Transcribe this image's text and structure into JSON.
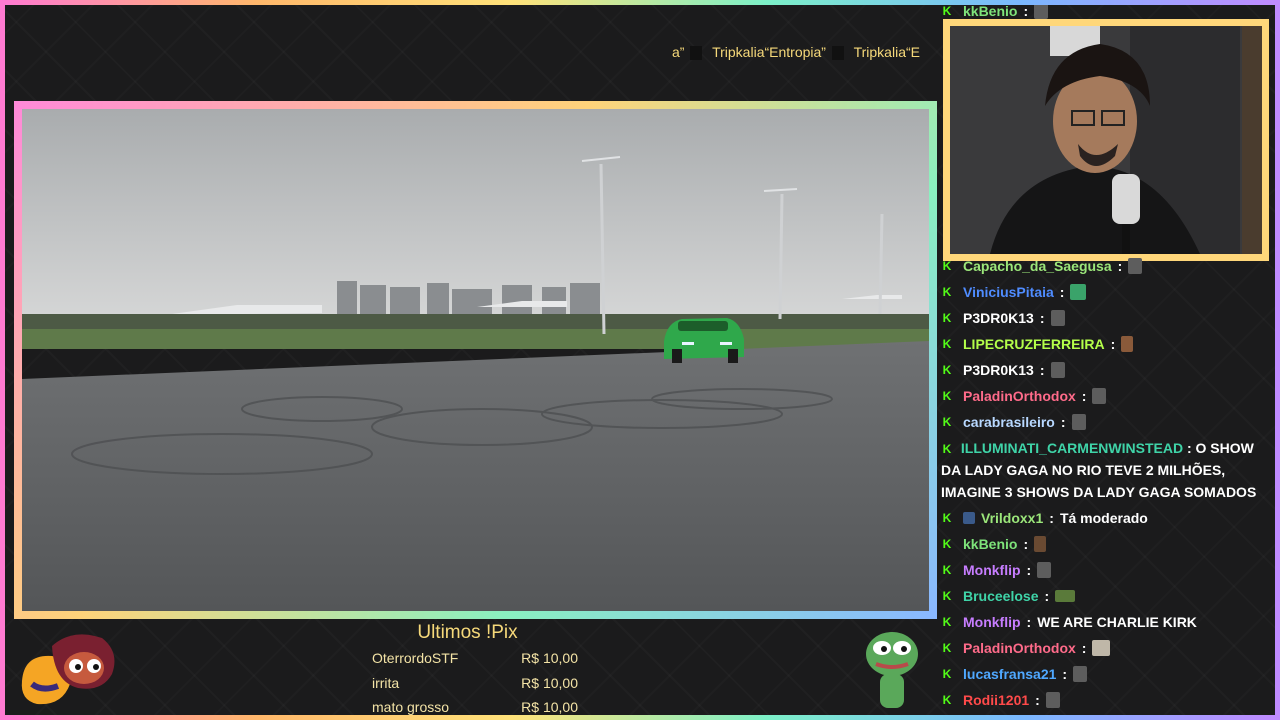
{
  "ticker": {
    "items": [
      "a”",
      "Tripkalia“Entropia”",
      "Tripkalia“E"
    ]
  },
  "pix": {
    "title": "Ultimos !Pix",
    "rows": [
      {
        "name": "OterrordoSTF",
        "amount": "R$ 10,00"
      },
      {
        "name": "irrita",
        "amount": "R$ 10,00"
      },
      {
        "name": "mato grosso",
        "amount": "R$ 10,00"
      }
    ]
  },
  "chat": {
    "badge_glyph": "K",
    "messages": [
      {
        "user": "kkBenio",
        "color": "#7ee37a",
        "text": ""
      },
      {
        "user": "Capacho_da_Saegusa",
        "color": "#9be67a",
        "text": ""
      },
      {
        "user": "ViniciusPitaia",
        "color": "#4f8cff",
        "text": ""
      },
      {
        "user": "P3DR0K13",
        "color": "#ffffff",
        "text": ""
      },
      {
        "user": "LIPECRUZFERREIRA",
        "color": "#b4ff4a",
        "text": ""
      },
      {
        "user": "P3DR0K13",
        "color": "#ffffff",
        "text": ""
      },
      {
        "user": "PaladinOrthodox",
        "color": "#ff6b8a",
        "text": ""
      },
      {
        "user": "carabrasileiro",
        "color": "#b8d8ff",
        "text": ""
      },
      {
        "user": "ILLUMINATI_CARMENWINSTEAD",
        "color": "#3fd4a8",
        "text": "O SHOW DA LADY GAGA NO RIO TEVE 2 MILHÕES, IMAGINE 3 SHOWS DA LADY GAGA SOMADOS"
      },
      {
        "user": "Vrildoxx1",
        "color": "#9be67a",
        "text": "Tá moderado"
      },
      {
        "user": "kkBenio",
        "color": "#7ee37a",
        "text": ""
      },
      {
        "user": "Monkflip",
        "color": "#c77dff",
        "text": ""
      },
      {
        "user": "Bruceelose",
        "color": "#3fd4a8",
        "text": ""
      },
      {
        "user": "Monkflip",
        "color": "#c77dff",
        "text": "WE ARE CHARLIE KIRK"
      },
      {
        "user": "PaladinOrthodox",
        "color": "#ff6b8a",
        "text": ""
      },
      {
        "user": "lucasfransa21",
        "color": "#4fa8ff",
        "text": ""
      },
      {
        "user": "Rodii1201",
        "color": "#ff4a4a",
        "text": ""
      }
    ]
  },
  "colors": {
    "accent_yellow": "#f6d97a",
    "kick_green": "#53fc18"
  }
}
